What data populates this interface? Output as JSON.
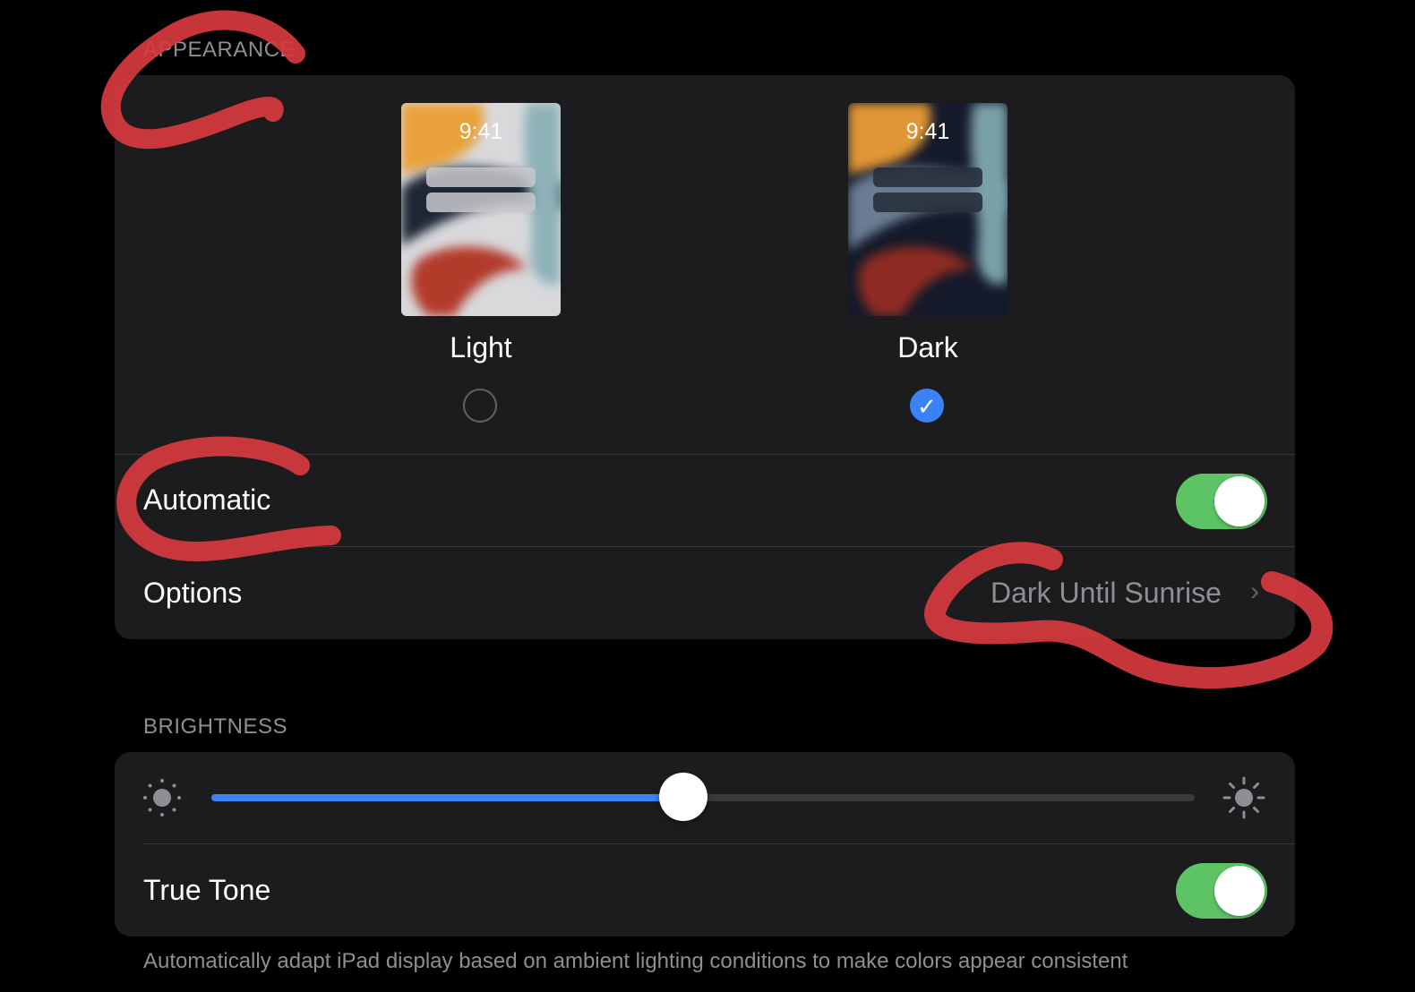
{
  "appearance": {
    "header": "APPEARANCE",
    "light": {
      "time": "9:41",
      "label": "Light",
      "selected": false
    },
    "dark": {
      "time": "9:41",
      "label": "Dark",
      "selected": true,
      "check_glyph": "✓"
    },
    "automatic": {
      "label": "Automatic",
      "on": true
    },
    "options": {
      "label": "Options",
      "value": "Dark Until Sunrise",
      "chevron": "›"
    }
  },
  "brightness": {
    "header": "BRIGHTNESS",
    "slider_level": 0.48,
    "min_icon": "sun-small-icon",
    "max_icon": "sun-large-icon",
    "true_tone": {
      "label": "True Tone",
      "on": true
    },
    "footer": "Automatically adapt iPad display based on ambient lighting conditions to make colors appear consistent"
  },
  "colors": {
    "accent_blue": "#3a82f7",
    "toggle_green": "#5dc466",
    "annotation_red": "#d63a3f"
  }
}
